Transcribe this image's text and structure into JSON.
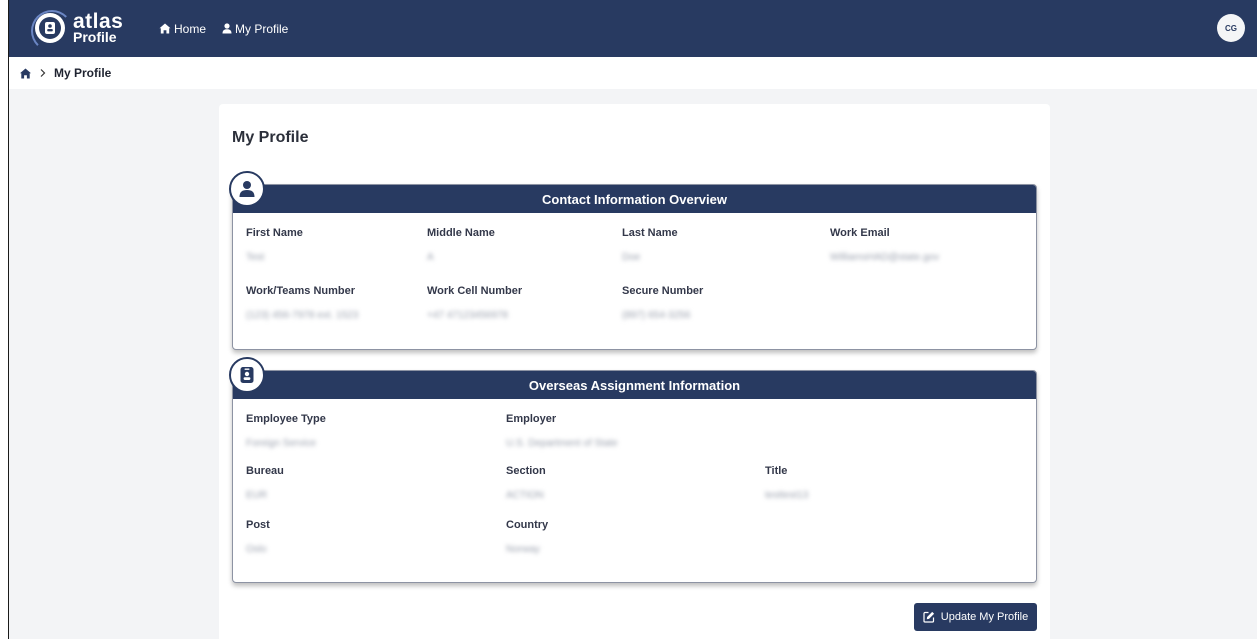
{
  "app": {
    "logo_line1": "atlas",
    "logo_line2": "Profile",
    "avatar_initials": "CG"
  },
  "nav": {
    "home_label": "Home",
    "profile_label": "My Profile"
  },
  "breadcrumb": {
    "current": "My Profile"
  },
  "page": {
    "title": "My Profile",
    "update_button": "Update My Profile"
  },
  "contact": {
    "header": "Contact Information Overview",
    "fields": {
      "first_name": {
        "label": "First Name",
        "value": "Test"
      },
      "middle_name": {
        "label": "Middle Name",
        "value": "A"
      },
      "last_name": {
        "label": "Last Name",
        "value": "Doe"
      },
      "work_email": {
        "label": "Work Email",
        "value": "WilliamsHAD@state.gov"
      },
      "teams_number": {
        "label": "Work/Teams Number",
        "value": "(123) 456-7978 ext. 1523"
      },
      "cell_number": {
        "label": "Work Cell Number",
        "value": "+47 47123456978"
      },
      "secure_number": {
        "label": "Secure Number",
        "value": "(897) 654-3256"
      }
    }
  },
  "overseas": {
    "header": "Overseas Assignment Information",
    "fields": {
      "employee_type": {
        "label": "Employee Type",
        "value": "Foreign Service"
      },
      "employer": {
        "label": "Employer",
        "value": "U.S. Department of State"
      },
      "bureau": {
        "label": "Bureau",
        "value": "EUR"
      },
      "section": {
        "label": "Section",
        "value": "ACTION"
      },
      "title": {
        "label": "Title",
        "value": "testtest13"
      },
      "post": {
        "label": "Post",
        "value": "Oslo"
      },
      "country": {
        "label": "Country",
        "value": "Norway"
      }
    }
  },
  "colors": {
    "brand_navy": "#283a61",
    "background": "#f3f4f6"
  }
}
